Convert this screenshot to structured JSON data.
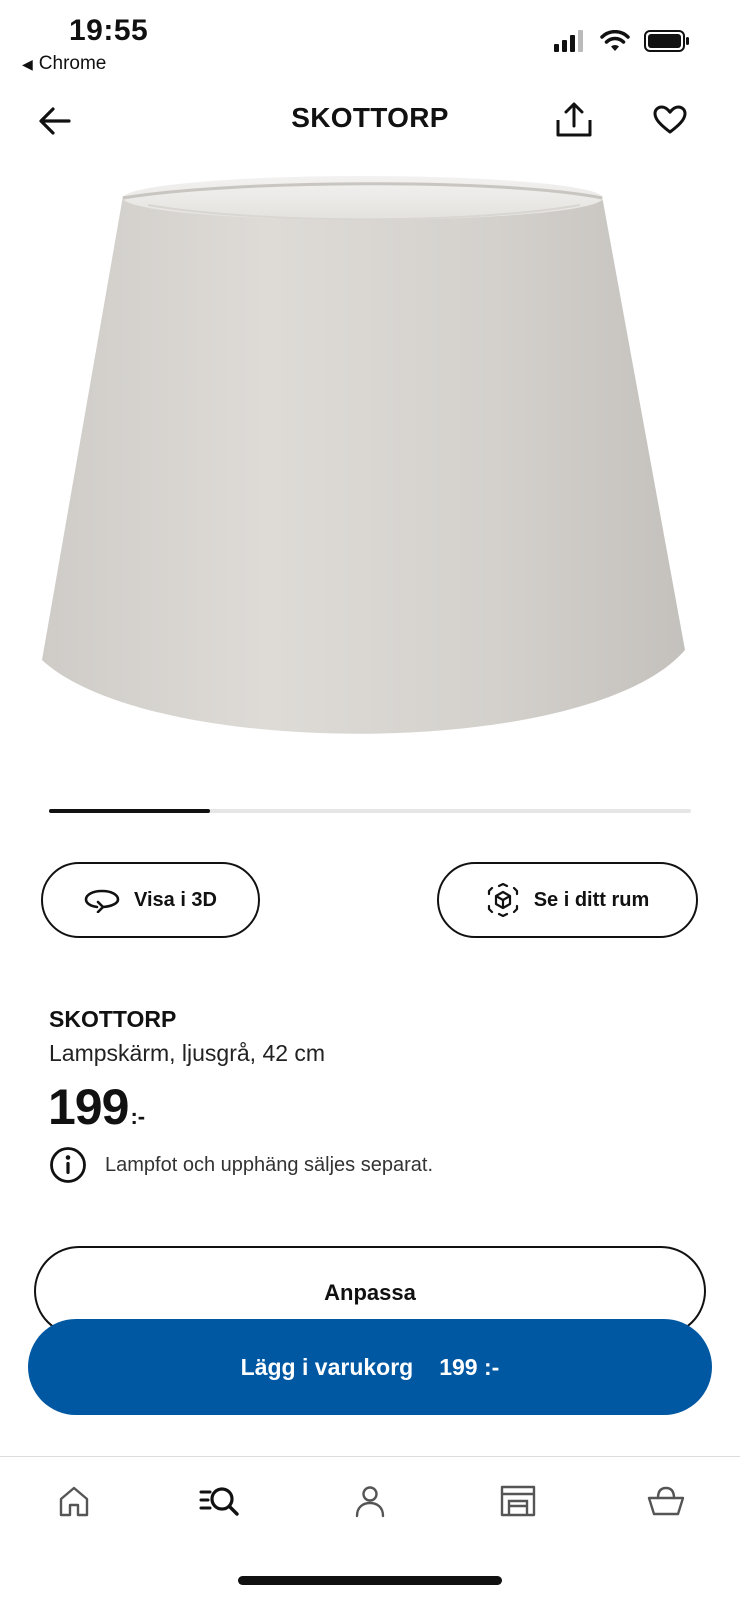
{
  "status_bar": {
    "time": "19:55",
    "back_app": "Chrome"
  },
  "header": {
    "title": "SKOTTORP"
  },
  "carousel": {
    "progress": 0.25
  },
  "actions": {
    "view_3d_label": "Visa i 3D",
    "view_room_label": "Se i ditt rum"
  },
  "product": {
    "name": "SKOTTORP",
    "description": "Lampskärm, ljusgrå, 42 cm",
    "price_integer": "199",
    "price_suffix": ":-",
    "info_note": "Lampfot och upphäng säljes separat."
  },
  "customize_button": {
    "label": "Anpassa"
  },
  "cart_button": {
    "label": "Lägg i varukorg",
    "price": "199 :-"
  },
  "nav": {
    "items": [
      "home-icon",
      "search-browse-icon",
      "profile-icon",
      "store-icon",
      "basket-icon"
    ]
  },
  "colors": {
    "primary_blue": "#0058a3",
    "lampshade_gray": "#d6d3cf"
  }
}
